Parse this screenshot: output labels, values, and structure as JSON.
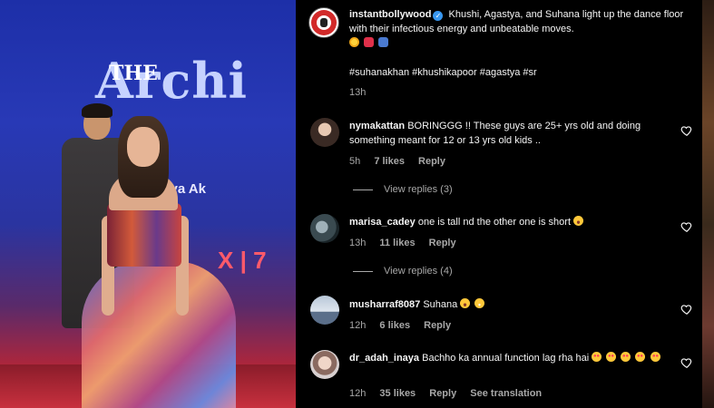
{
  "media": {
    "stage_the": "THE",
    "stage_title": "Archi",
    "stage_subtitle": "m by Zoya Ak",
    "stage_mark": "X  |  7"
  },
  "post": {
    "username": "instantbollywood",
    "caption": "Khushi, Agastya, and Suhana light up the dance floor with their infectious energy and unbeatable moves.",
    "hashtags": "#suhanakhan #khushikapoor #agastya #sr",
    "time": "13h"
  },
  "comments": [
    {
      "username": "nymakattan",
      "text": "BORINGGG !! These guys are 25+ yrs old and doing something meant for 12 or 13 yrs old kids ..",
      "time": "5h",
      "likes": "7 likes",
      "reply": "Reply",
      "view_replies": "View replies (3)"
    },
    {
      "username": "marisa_cadey",
      "text": "one is tall nd the other one is short",
      "time": "13h",
      "likes": "11 likes",
      "reply": "Reply",
      "view_replies": "View replies (4)"
    },
    {
      "username": "musharraf8087",
      "text": "Suhana",
      "time": "12h",
      "likes": "6 likes",
      "reply": "Reply"
    },
    {
      "username": "dr_adah_inaya",
      "text": "Bachho ka annual function lag rha hai",
      "time": "12h",
      "likes": "35 likes",
      "reply": "Reply",
      "see_translation": "See translation"
    }
  ],
  "icons": {
    "heart": "heart-outline-icon",
    "verified": "verified-badge-icon",
    "accent": "#3897f0",
    "heart_color": "#f5f5f5"
  }
}
